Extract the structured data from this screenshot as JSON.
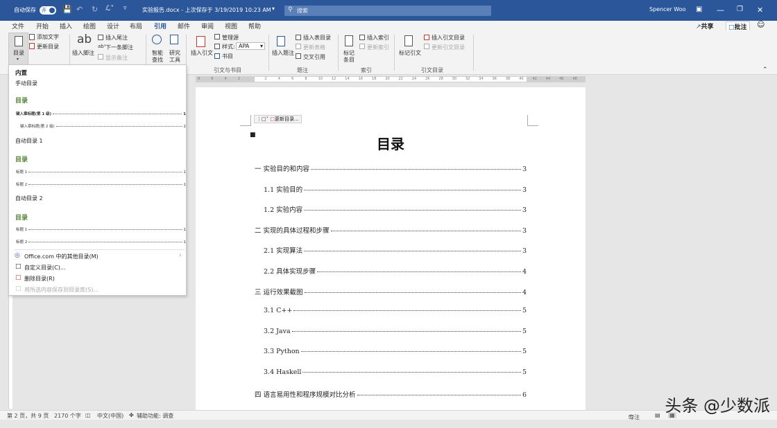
{
  "titlebar": {
    "autosave_label": "自动保存",
    "autosave_state": "开",
    "doc_title": "实验报告.docx - 上次保存于 3/19/2019 10:23 AM",
    "search_placeholder": "搜索",
    "user_name": "Spencer Woo"
  },
  "tabs": [
    "文件",
    "开始",
    "插入",
    "绘图",
    "设计",
    "布局",
    "引用",
    "邮件",
    "审阅",
    "视图",
    "帮助"
  ],
  "active_tab": "引用",
  "tab_right": {
    "share": "共享",
    "comment": "批注"
  },
  "ribbon": {
    "toc": {
      "button": "目录",
      "add_text": "添加文字",
      "update_toc": "更新目录"
    },
    "footnotes": {
      "insert_footnote": "插入脚注",
      "insert_endnote": "插入尾注",
      "next_footnote": "下一条脚注",
      "show_notes": "显示备注"
    },
    "research": {
      "smart_lookup_1": "智能",
      "smart_lookup_2": "查找",
      "researcher_1": "研究",
      "researcher_2": "工具"
    },
    "citations": {
      "insert_citation": "插入引文",
      "manage_sources": "管理源",
      "style_label": "样式:",
      "style_value": "APA",
      "bibliography": "书目",
      "group_label": "引文与书目"
    },
    "captions": {
      "insert_caption": "插入题注",
      "insert_table_of_figures": "插入表目录",
      "update_table": "更新表格",
      "cross_reference": "交叉引用",
      "group_label": "题注"
    },
    "index": {
      "mark_entry_1": "标记",
      "mark_entry_2": "条目",
      "insert_index": "插入索引",
      "update_index": "更新索引",
      "group_label": "索引"
    },
    "authorities": {
      "mark_citation": "标记引文",
      "insert_table": "插入引文目录",
      "update_table": "更新引文目录",
      "group_label": "引文目录"
    }
  },
  "ruler_ticks": [
    "8",
    "6",
    "4",
    "2",
    "",
    "2",
    "4",
    "6",
    "8",
    "10",
    "12",
    "14",
    "16",
    "18",
    "20",
    "22",
    "24",
    "26",
    "28",
    "30",
    "32",
    "34",
    "36",
    "38",
    "40",
    "42",
    "44",
    "46",
    "48"
  ],
  "toc_panel": {
    "builtin": "内置",
    "manual_title": "手动目录",
    "sample1": {
      "heading": "目录",
      "lines": [
        {
          "t": "键入章标题(第 1 级)",
          "p": "1"
        },
        {
          "t": "键入章标题(第 2 级)",
          "p": "2"
        }
      ]
    },
    "auto1_title": "自动目录 1",
    "sample2": {
      "heading": "目录",
      "lines": [
        {
          "t": "标题 1",
          "p": "1"
        },
        {
          "t": "标题 2",
          "p": "1"
        }
      ]
    },
    "auto2_title": "自动目录 2",
    "sample3": {
      "heading": "目录",
      "lines": [
        {
          "t": "标题 1",
          "p": "1"
        },
        {
          "t": "标题 2",
          "p": "1"
        }
      ]
    },
    "menu": [
      {
        "label": "Office.com 中的其他目录(M)",
        "disabled": false
      },
      {
        "label": "自定义目录(C)...",
        "disabled": false
      },
      {
        "label": "删除目录(R)",
        "disabled": false
      },
      {
        "label": "将所选内容保存到目录库(S)...",
        "disabled": true
      }
    ]
  },
  "document": {
    "mini_toolbar_update": "更新目录...",
    "title": "目录",
    "toc": [
      {
        "text": "一  实验目的和内容",
        "page": "3",
        "level": 1
      },
      {
        "text": "1.1  实验目的",
        "page": "3",
        "level": 2
      },
      {
        "text": "1.2  实验内容",
        "page": "3",
        "level": 2
      },
      {
        "text": "二  实现的具体过程和步骤",
        "page": "3",
        "level": 1
      },
      {
        "text": "2.1  实现算法",
        "page": "3",
        "level": 2
      },
      {
        "text": "2.2  具体实现步骤",
        "page": "4",
        "level": 2
      },
      {
        "text": "三  运行效果截图",
        "page": "4",
        "level": 1
      },
      {
        "text": "3.1 C++",
        "page": "5",
        "level": 2
      },
      {
        "text": "3.2 Java",
        "page": "5",
        "level": 2
      },
      {
        "text": "3.3 Python",
        "page": "5",
        "level": 2
      },
      {
        "text": "3.4 Haskell",
        "page": "5",
        "level": 2
      },
      {
        "text": "四  语言易用性和程序规模对比分析",
        "page": "6",
        "level": 1
      }
    ]
  },
  "statusbar": {
    "page": "第 2 页，共 9 页",
    "words": "2170 个字",
    "language": "中文(中国)",
    "accessibility": "辅助功能: 调查",
    "focus": "专注"
  },
  "watermark": "头条 @少数派",
  "colors": {
    "title_bar": "#2b579a",
    "toc_green": "#538135"
  }
}
